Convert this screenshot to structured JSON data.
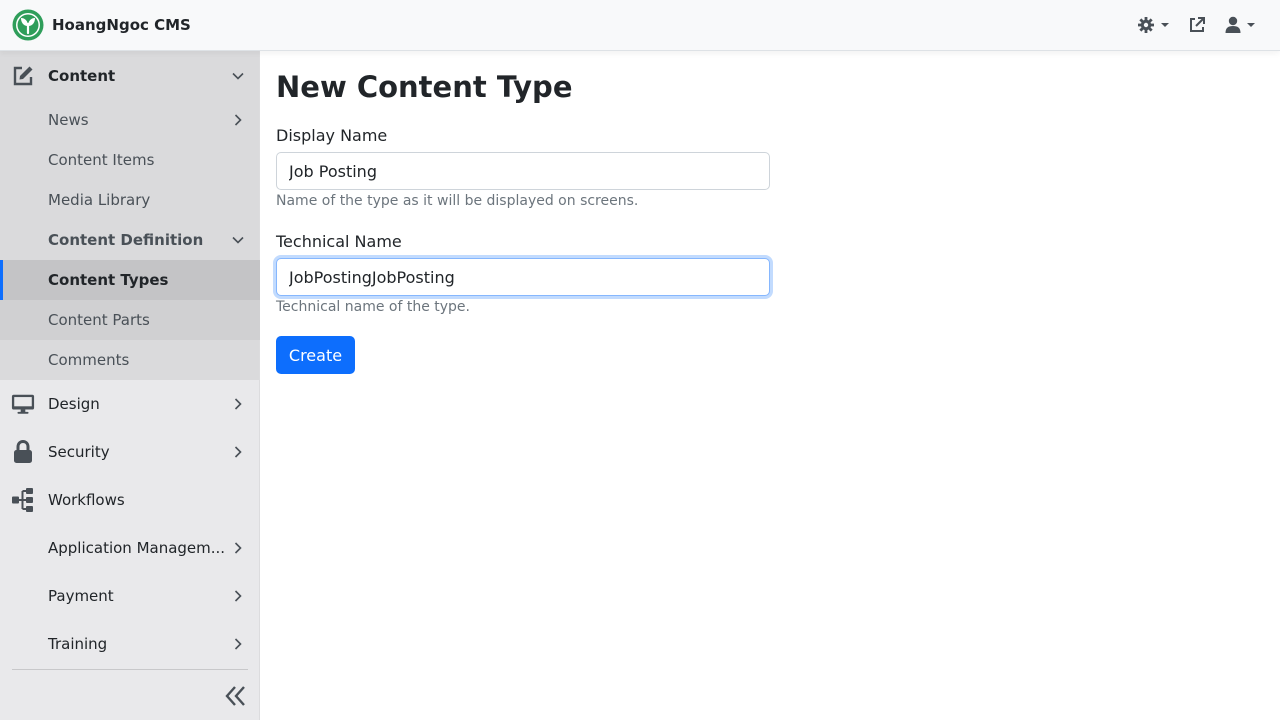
{
  "brand": {
    "name": "HoangNgoc CMS",
    "accent": "#2f9e5a"
  },
  "colors": {
    "primary": "#0d6efd",
    "active_indicator": "#0d6efd"
  },
  "navbar": {
    "actions": [
      {
        "icon": "theme-gear-icon",
        "has_dropdown": true
      },
      {
        "icon": "external-link-icon",
        "has_dropdown": false
      },
      {
        "icon": "user-icon",
        "has_dropdown": true
      }
    ]
  },
  "sidebar": {
    "content": {
      "label": "Content",
      "icon": "edit-icon",
      "expanded": true
    },
    "news": {
      "label": "News"
    },
    "content_items": {
      "label": "Content Items"
    },
    "media_library": {
      "label": "Media Library"
    },
    "content_definition": {
      "label": "Content Definition",
      "expanded": true
    },
    "content_types": {
      "label": "Content Types",
      "active": true
    },
    "content_parts": {
      "label": "Content Parts"
    },
    "comments": {
      "label": "Comments"
    },
    "design": {
      "label": "Design",
      "icon": "monitor-icon"
    },
    "security": {
      "label": "Security",
      "icon": "lock-icon"
    },
    "workflows": {
      "label": "Workflows",
      "icon": "sitemap-icon"
    },
    "application_management": {
      "label": "Application Managem..."
    },
    "payment": {
      "label": "Payment"
    },
    "training": {
      "label": "Training"
    }
  },
  "main": {
    "title": "New Content Type",
    "display_name": {
      "label": "Display Name",
      "value": "Job Posting",
      "hint": "Name of the type as it will be displayed on screens."
    },
    "technical_name": {
      "label": "Technical Name",
      "value": "JobPostingJobPosting",
      "hint": "Technical name of the type."
    },
    "create_label": "Create"
  }
}
